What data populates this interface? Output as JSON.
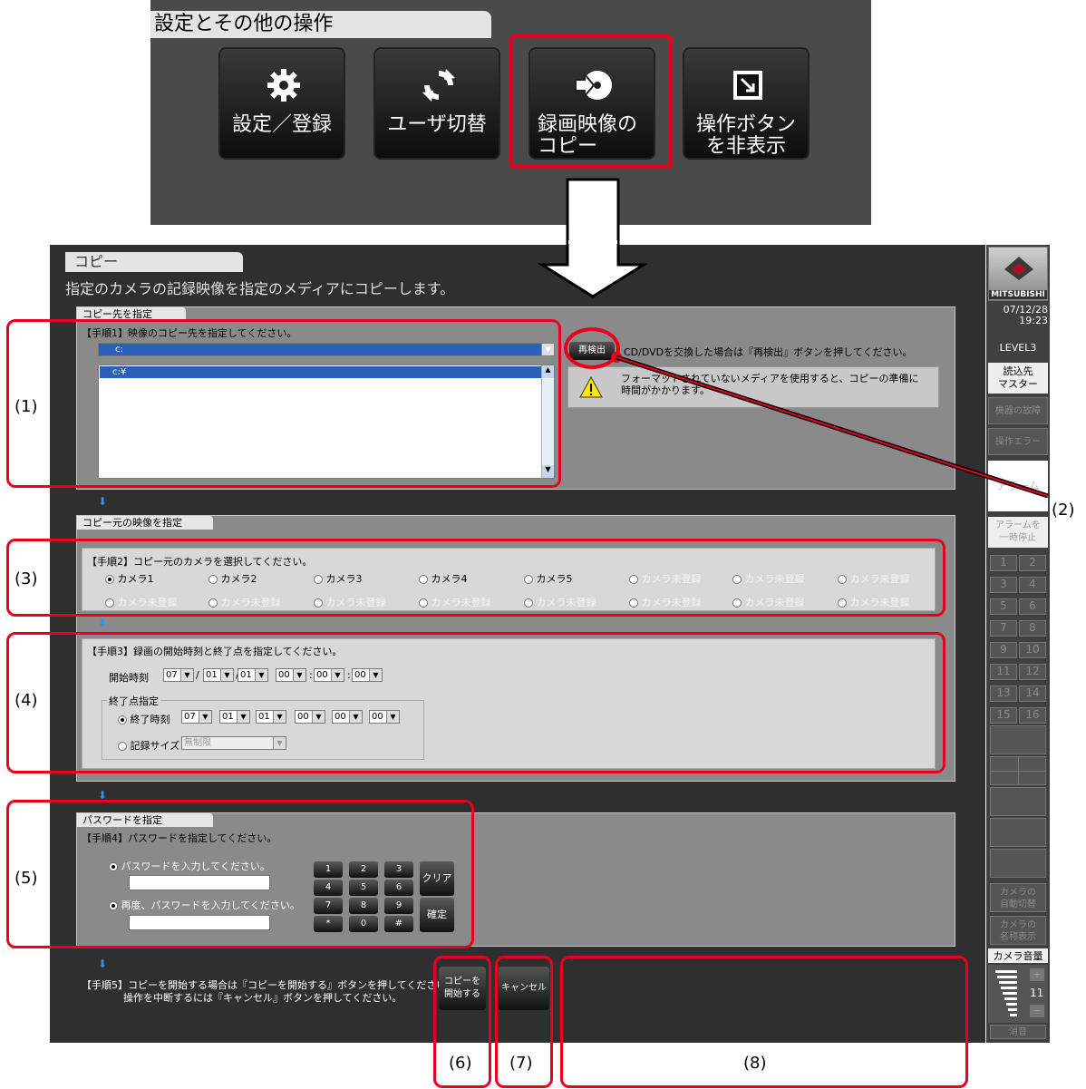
{
  "top_panel": {
    "title": "設定とその他の操作",
    "buttons": [
      {
        "label": "設定／登録",
        "icon": "gear-icon"
      },
      {
        "label": "ユーザ切替",
        "icon": "refresh-icon"
      },
      {
        "label": "録画映像の\nコピー",
        "icon": "disc-copy-icon"
      },
      {
        "label": "操作ボタン\nを非表示",
        "icon": "hide-icon"
      }
    ]
  },
  "window": {
    "title": "コピー",
    "description": "指定のカメラの記録映像を指定のメディアにコピーします。"
  },
  "dest": {
    "tab": "コピー先を指定",
    "step": "【手順1】映像のコピー先を指定してください。",
    "drive": "c:",
    "folder": "c:¥",
    "redetect": "再検出",
    "redetect_hint": "CD/DVDを交換した場合は『再検出』ボタンを押してください。",
    "warning": "フォーマットされていないメディアを使用すると、コピーの準備に時間がかかります。"
  },
  "source": {
    "tab": "コピー元の映像を指定",
    "step": "【手順2】コピー元のカメラを選択してください。",
    "cameras_row1": [
      "カメラ1",
      "カメラ2",
      "カメラ3",
      "カメラ4",
      "カメラ5",
      "カメラ未登録",
      "カメラ未登録",
      "カメラ未登録"
    ],
    "cameras_row2": [
      "カメラ未登録",
      "カメラ未登録",
      "カメラ未登録",
      "カメラ未登録",
      "カメラ未登録",
      "カメラ未登録",
      "カメラ未登録",
      "カメラ未登録"
    ]
  },
  "time": {
    "step": "【手順3】録画の開始時刻と終了点を指定してください。",
    "start_label": "開始時刻",
    "start": [
      "07",
      "01",
      "01",
      "00",
      "00",
      "00"
    ],
    "end_group": "終了点指定",
    "end_label": "終了時刻",
    "end": [
      "07",
      "01",
      "01",
      "00",
      "00",
      "00"
    ],
    "size_label": "記録サイズ",
    "size_value": "無制限"
  },
  "password": {
    "tab": "パスワードを指定",
    "step": "【手順4】パスワードを指定してください。",
    "prompt1": "パスワードを入力してください。",
    "prompt2": "再度、パスワードを入力してください。",
    "keys": [
      "1",
      "2",
      "3",
      "4",
      "5",
      "6",
      "7",
      "8",
      "9",
      "*",
      "0",
      "#"
    ],
    "clear": "クリア",
    "confirm": "確定"
  },
  "final": {
    "step_line1": "【手順5】コピーを開始する場合は『コピーを開始する』ボタンを押してください。",
    "step_line2": "操作を中断するには『キャンセル』ボタンを押してください。",
    "start_btn": "コピーを\n開始する",
    "cancel_btn": "キャンセル"
  },
  "side": {
    "brand": "MITSUBISHI",
    "date": "07/12/28",
    "time": "19:23",
    "level": "LEVEL3",
    "read_dest": "読込先\nマスター",
    "device_fault": "機器の故障",
    "op_error": "操作エラー",
    "alarm": "アラーム",
    "alarm_pause": "アラームを\n一時停止",
    "numbers": [
      "1",
      "2",
      "3",
      "4",
      "5",
      "6",
      "7",
      "8",
      "9",
      "10",
      "11",
      "12",
      "13",
      "14",
      "15",
      "16"
    ],
    "auto_switch": "カメラの\n自動切替",
    "name_display": "カメラの\n名称表示",
    "volume_label": "カメラ音量",
    "volume_value": "11",
    "mute": "消音"
  },
  "callouts": {
    "c1": "(1)",
    "c2": "(2)",
    "c3": "(3)",
    "c4": "(4)",
    "c5": "(5)",
    "c6": "(6)",
    "c7": "(7)",
    "c8": "(8)"
  },
  "colors": {
    "highlight": "#e8001c",
    "window_bg": "#2f2f2f",
    "section_bg": "#8a8a8a"
  }
}
